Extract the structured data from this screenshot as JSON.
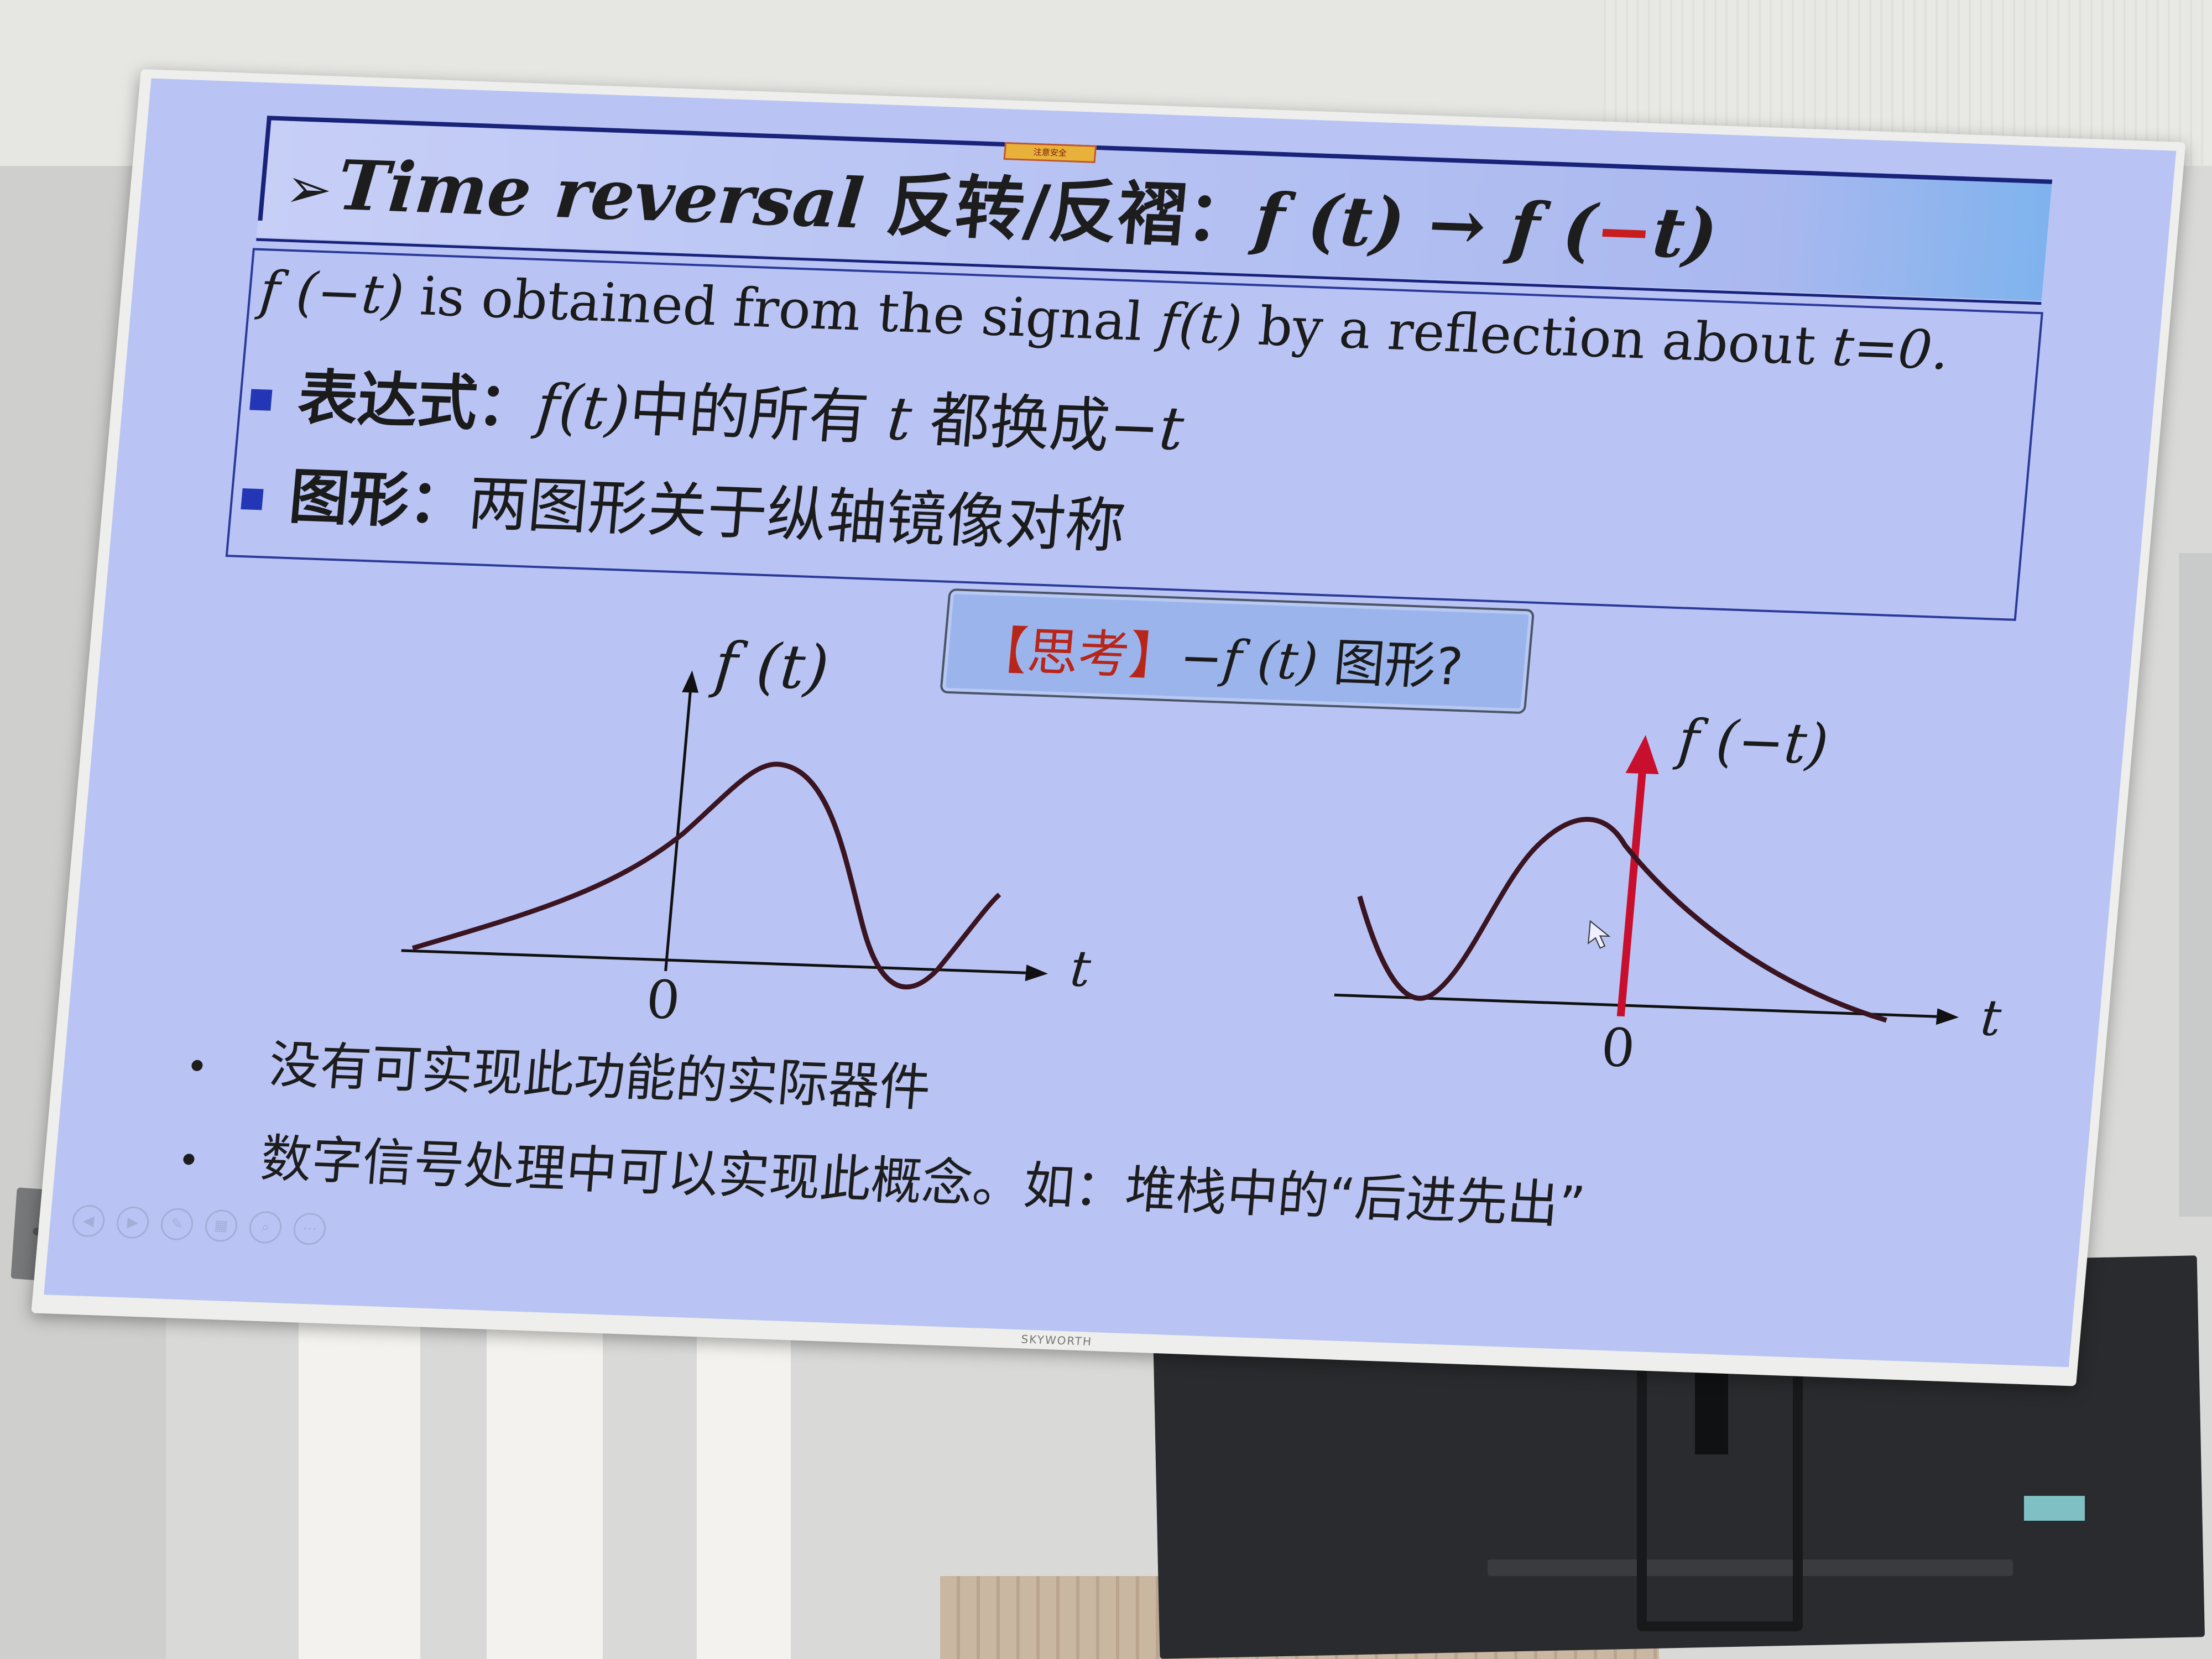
{
  "slide": {
    "title": {
      "arrow": "➢",
      "english": "Time reversal",
      "chinese": "反转/反褶：",
      "math_lhs": "f (t) → f (",
      "math_neg": "−",
      "math_rhs": "t)"
    },
    "definition": {
      "p1": "f (−t)",
      "p2": " is obtained from the signal ",
      "p3": "f(t)",
      "p4": " by a reflection about ",
      "p5": "t=0."
    },
    "bullets": [
      {
        "label": "表达式：",
        "math": "f(t)",
        "text": "中的所有 ",
        "math2": "t",
        "text2": " 都换成",
        "math3": "−t"
      },
      {
        "label": "图形：",
        "text": "两图形关于纵轴镜像对称"
      }
    ],
    "think": {
      "bracket_open": "【思考】",
      "math": "−f (t)",
      "text": " 图形?"
    },
    "graph_left": {
      "ylabel": "f (t)",
      "xlabel": "t",
      "origin": "0"
    },
    "graph_right": {
      "ylabel": "f (−t)",
      "xlabel": "t",
      "origin": "0"
    },
    "notes": [
      "没有可实现此功能的实际器件",
      "数字信号处理中可以实现此概念。如：堆栈中的“后进先出”"
    ],
    "warning_label": "注意安全"
  },
  "tv": {
    "brand": "SKYWORTH"
  },
  "colors": {
    "slide_bg": "#b9c4f4",
    "title_line": "#19237a",
    "bullet_square": "#2336b5",
    "red_axis": "#c8102e",
    "curve": "#3a1420"
  }
}
